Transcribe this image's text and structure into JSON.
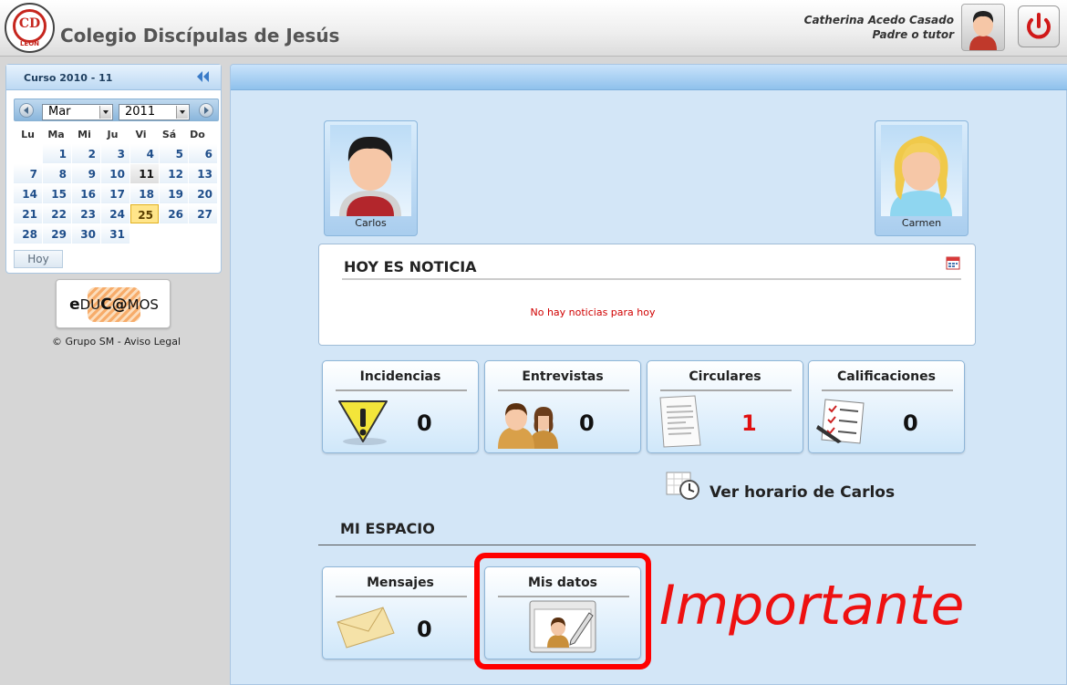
{
  "header": {
    "logo_text": "CD",
    "logo_city": "LEON",
    "school_name": "Colegio Discípulas de Jesús",
    "user_name": "Catherina Acedo Casado",
    "user_role": "Padre o tutor"
  },
  "sidebar": {
    "course": "Curso 2010 - 11",
    "calendar": {
      "month": "Mar",
      "year": "2011",
      "weekdays": [
        "Lu",
        "Ma",
        "Mi",
        "Ju",
        "Vi",
        "Sá",
        "Do"
      ],
      "days": [
        "",
        "1",
        "2",
        "3",
        "4",
        "5",
        "6",
        "7",
        "8",
        "9",
        "10",
        "11",
        "12",
        "13",
        "14",
        "15",
        "16",
        "17",
        "18",
        "19",
        "20",
        "21",
        "22",
        "23",
        "24",
        "25",
        "26",
        "27",
        "28",
        "29",
        "30",
        "31"
      ],
      "highlighted_day": "11",
      "selected_day": "25",
      "today_button": "Hoy"
    },
    "educamos": {
      "e": "e",
      "mid1": "DU",
      "c": "C",
      "at": "@",
      "end": "MOS"
    },
    "copyright": "Grupo SM - Aviso Legal"
  },
  "main": {
    "students": [
      {
        "name": "Carlos"
      },
      {
        "name": "Carmen"
      }
    ],
    "news": {
      "title": "HOY ES NOTICIA",
      "empty_message": "No hay noticias para hoy"
    },
    "cards": [
      {
        "title": "Incidencias",
        "count": "0",
        "icon": "warning-icon"
      },
      {
        "title": "Entrevistas",
        "count": "0",
        "icon": "people-icon"
      },
      {
        "title": "Circulares",
        "count": "1",
        "icon": "document-icon"
      },
      {
        "title": "Calificaciones",
        "count": "0",
        "icon": "checklist-icon"
      }
    ],
    "schedule_link": "Ver horario de Carlos",
    "my_space": {
      "title": "MI ESPACIO",
      "messages_title": "Mensajes",
      "messages_count": "0",
      "my_data_title": "Mis datos"
    },
    "annotation": "Importante"
  },
  "colors": {
    "accent_blue": "#8fc1ec",
    "alert_red": "#ee1111",
    "selected_day": "#ffe58a"
  }
}
